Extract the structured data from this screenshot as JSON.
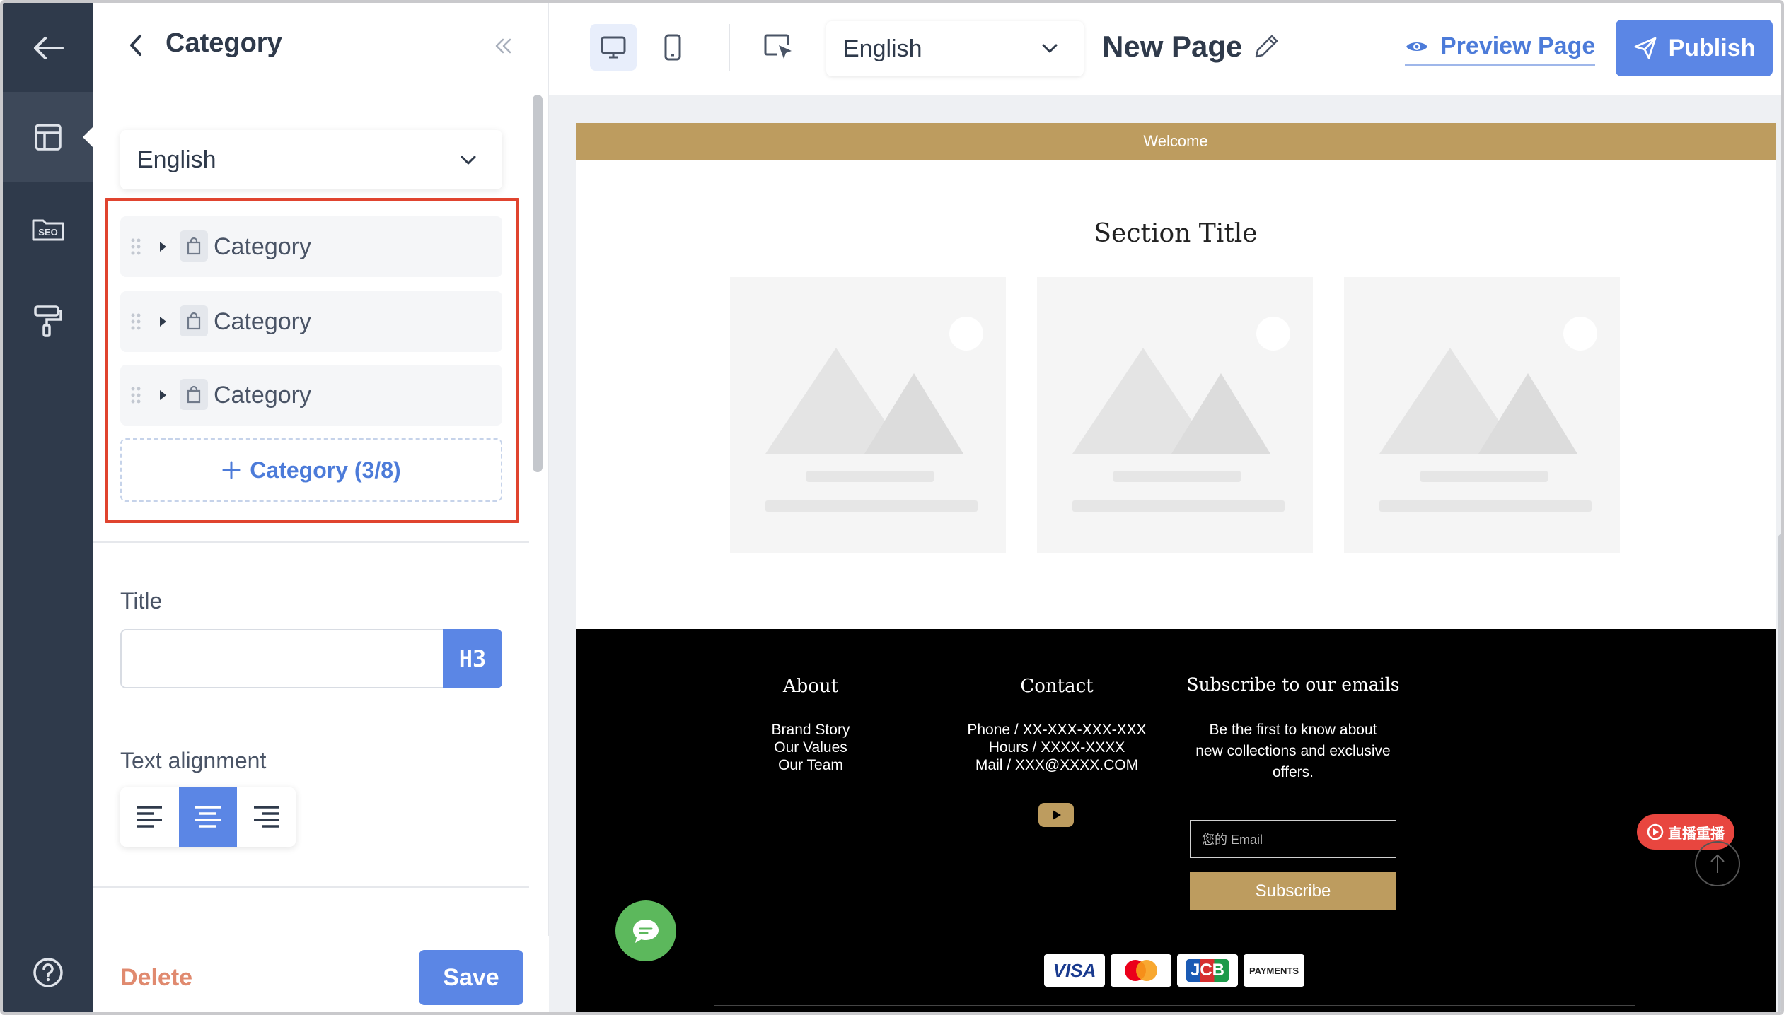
{
  "panel": {
    "title": "Category",
    "language": "English",
    "categories": [
      {
        "label": "Category"
      },
      {
        "label": "Category"
      },
      {
        "label": "Category"
      }
    ],
    "add_category_label": "Category (3/8)",
    "title_field_label": "Title",
    "title_value": "",
    "heading_level": "H3",
    "text_alignment_label": "Text alignment",
    "text_alignment_selected": "center",
    "delete_label": "Delete",
    "save_label": "Save"
  },
  "toolbar": {
    "language": "English",
    "page_name": "New Page",
    "preview_label": "Preview Page",
    "publish_label": "Publish",
    "view_mode": "desktop"
  },
  "site": {
    "welcome_text": "Welcome",
    "section_title": "Section Title",
    "footer": {
      "about": {
        "heading": "About",
        "lines": [
          "Brand Story",
          "Our Values",
          "Our Team"
        ]
      },
      "contact": {
        "heading": "Contact",
        "lines": [
          "Phone / XX-XXX-XXX-XXX",
          "Hours / XXXX-XXXX",
          "Mail / XXX@XXXX.COM"
        ]
      },
      "subscribe": {
        "heading": "Subscribe to our emails",
        "description": "Be the first to know about new collections and exclusive offers.",
        "email_placeholder": "您的 Email",
        "button_label": "Subscribe"
      },
      "payments": [
        "VISA",
        "",
        "JCB",
        "PAYMENTS"
      ]
    }
  },
  "overlays": {
    "live_replay_label": "直播重播"
  },
  "colors": {
    "sidebar": "#2f3a4b",
    "accent": "#5b86e5",
    "brand_gold": "#bd9c5f",
    "highlight": "#e0442f",
    "delete": "#e08a6f"
  },
  "icons": [
    "back-arrow-icon",
    "layout-icon",
    "seo-icon",
    "paint-roller-icon",
    "help-icon",
    "chevron-left-icon",
    "double-chevron-left-icon",
    "desktop-icon",
    "mobile-icon",
    "cursor-select-icon",
    "pencil-icon",
    "eye-icon",
    "send-icon",
    "drag-handle-icon",
    "caret-right-icon",
    "shopping-bag-icon",
    "plus-icon",
    "youtube-icon",
    "chat-icon",
    "arrow-up-icon"
  ]
}
